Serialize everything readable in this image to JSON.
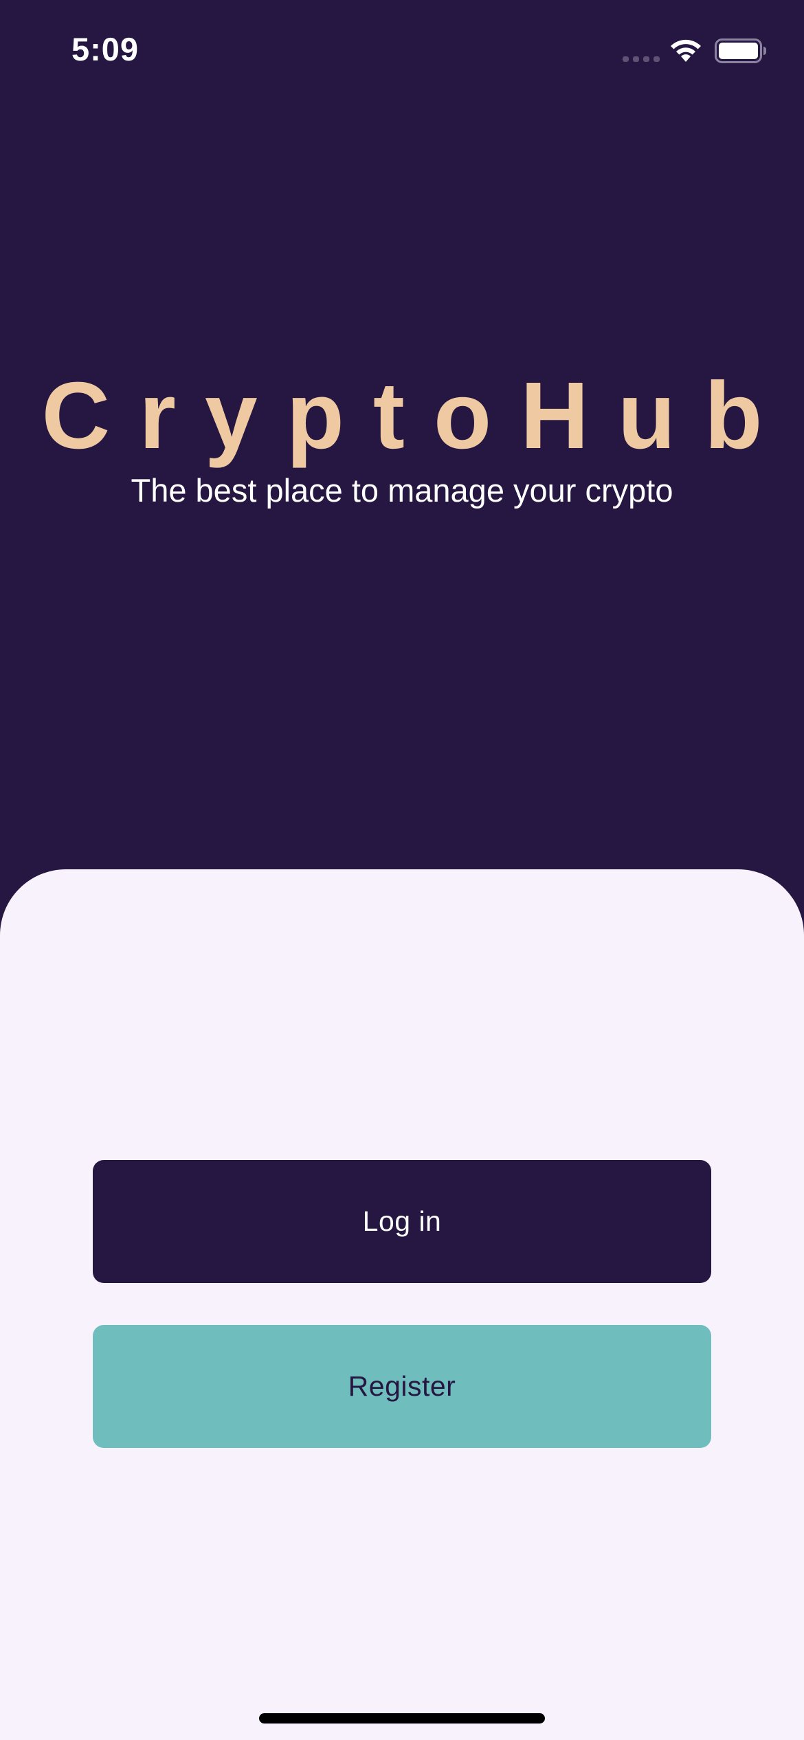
{
  "status_bar": {
    "time": "5:09"
  },
  "hero": {
    "title": "CryptoHub",
    "subtitle": "The best place to manage your crypto"
  },
  "actions": {
    "login_label": "Log in",
    "register_label": "Register"
  },
  "colors": {
    "background_dark": "#251741",
    "title_accent": "#efc9a1",
    "sheet_background": "#f8f2fc",
    "register_button": "#6fbdbd"
  },
  "icons": [
    "cellular-signal-icon",
    "wifi-icon",
    "battery-icon"
  ]
}
